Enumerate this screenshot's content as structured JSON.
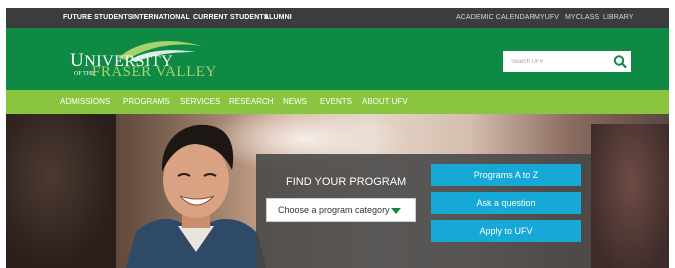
{
  "topbar": {
    "left": [
      "FUTURE STUDENTS",
      "INTERNATIONAL",
      "CURRENT STUDENTS",
      "ALUMNI"
    ],
    "right": [
      "ACADEMIC CALENDAR",
      "MYUFV",
      "MYCLASS",
      "LIBRARY"
    ]
  },
  "logo": {
    "line1_big": "U",
    "line1_rest": "NIVERSITY",
    "of_the": "OF THE",
    "line2": "FRASER VALLEY"
  },
  "search": {
    "placeholder": "Search UFV",
    "icon": "search-icon"
  },
  "nav": [
    "ADMISSIONS",
    "PROGRAMS",
    "SERVICES",
    "RESEARCH",
    "NEWS",
    "EVENTS",
    "ABOUT UFV"
  ],
  "finder": {
    "title": "FIND YOUR PROGRAM",
    "select_value": "Choose a program category",
    "buttons": [
      "Programs A to Z",
      "Ask a question",
      "Apply to UFV"
    ]
  },
  "colors": {
    "topbar": "#3c3c3c",
    "header_green": "#0f8a45",
    "nav_green": "#8bc53f",
    "button_blue": "#16a8d6",
    "logo_accent": "#a8d26e"
  }
}
